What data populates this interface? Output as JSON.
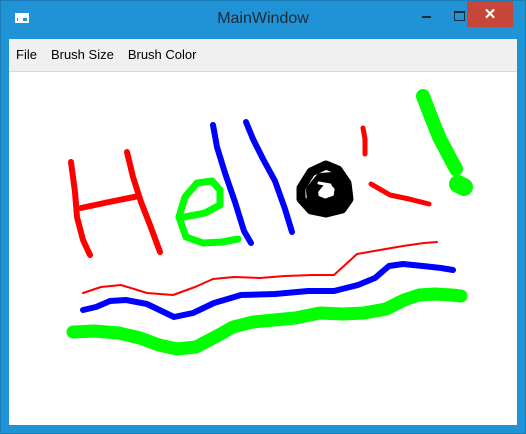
{
  "window": {
    "title": "MainWindow",
    "accent": "#1f93d6",
    "close_color": "#c7463a"
  },
  "controls": {
    "close_glyph": "✕"
  },
  "menu": {
    "items": [
      {
        "label": "File"
      },
      {
        "label": "Brush Size"
      },
      {
        "label": "Brush Color"
      }
    ]
  },
  "canvas": {
    "background": "#ffffff",
    "brush_colors": [
      "#ff0000",
      "#00ff00",
      "#0000ff",
      "#000000"
    ]
  }
}
